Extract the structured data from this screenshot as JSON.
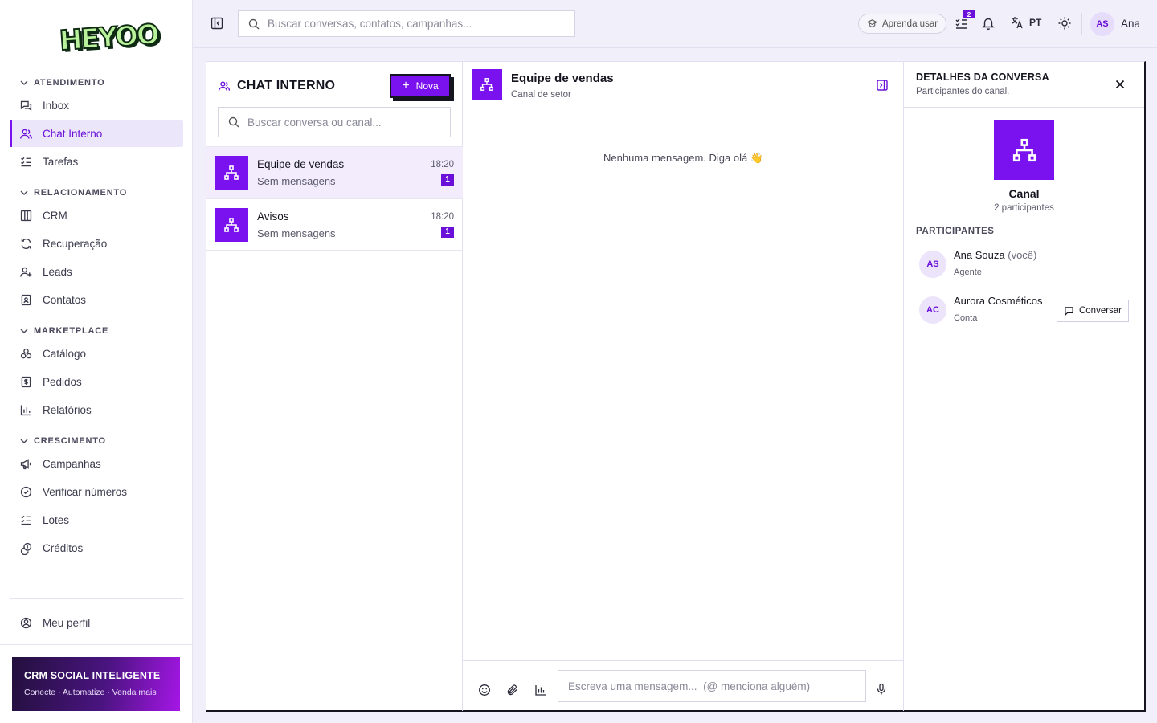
{
  "brand": {
    "logo_text": "HEYOO"
  },
  "sidebar": {
    "sections": [
      {
        "title": "ATENDIMENTO",
        "items": [
          {
            "label": "Inbox",
            "icon": "inbox-icon"
          },
          {
            "label": "Chat Interno",
            "icon": "users-icon",
            "active": true
          },
          {
            "label": "Tarefas",
            "icon": "tasks-icon"
          }
        ]
      },
      {
        "title": "RELACIONAMENTO",
        "items": [
          {
            "label": "CRM",
            "icon": "columns-icon"
          },
          {
            "label": "Recuperação",
            "icon": "refresh-icon"
          },
          {
            "label": "Leads",
            "icon": "user-plus-icon"
          },
          {
            "label": "Contatos",
            "icon": "contact-book-icon"
          }
        ]
      },
      {
        "title": "MARKETPLACE",
        "items": [
          {
            "label": "Catálogo",
            "icon": "boxes-icon"
          },
          {
            "label": "Pedidos",
            "icon": "receipt-icon"
          },
          {
            "label": "Relatórios",
            "icon": "bar-chart-icon"
          }
        ]
      },
      {
        "title": "CRESCIMENTO",
        "items": [
          {
            "label": "Campanhas",
            "icon": "megaphone-icon"
          },
          {
            "label": "Verificar números",
            "icon": "check-circle-icon"
          },
          {
            "label": "Lotes",
            "icon": "list-check-icon"
          },
          {
            "label": "Créditos",
            "icon": "coins-icon"
          }
        ]
      }
    ],
    "profile_label": "Meu perfil",
    "promo": {
      "title": "CRM SOCIAL INTELIGENTE",
      "subtitle": "Conecte · Automatize · Venda mais"
    }
  },
  "topbar": {
    "search_placeholder": "Buscar conversas, contatos, campanhas...",
    "learn_label": "Aprenda usar",
    "tasks_badge": "2",
    "lang": "PT",
    "user_initials": "AS",
    "user_name": "Ana"
  },
  "chat_list": {
    "title": "CHAT INTERNO",
    "new_label": "Nova",
    "search_placeholder": "Buscar conversa ou canal...",
    "conversations": [
      {
        "name": "Equipe de vendas",
        "preview": "Sem mensagens",
        "time": "18:20",
        "unread": "1",
        "active": true
      },
      {
        "name": "Avisos",
        "preview": "Sem mensagens",
        "time": "18:20",
        "unread": "1",
        "active": false
      }
    ]
  },
  "chat": {
    "name": "Equipe de vendas",
    "subtitle": "Canal de setor",
    "empty_message": "Nenhuma mensagem. Diga olá 👋",
    "composer_placeholder": "Escreva uma mensagem...  (@ menciona alguém)"
  },
  "details": {
    "title": "DETALHES DA CONVERSA",
    "subtitle": "Participantes do canal.",
    "kind": "Canal",
    "participants_count": "2 participantes",
    "participants_label": "PARTICIPANTES",
    "participants": [
      {
        "initials": "AS",
        "name": "Ana Souza",
        "suffix": "(você)",
        "role": "Agente"
      },
      {
        "initials": "AC",
        "name": "Aurora Cosméticos",
        "suffix": "",
        "role": "Conta",
        "action": "Conversar"
      }
    ]
  },
  "colors": {
    "accent": "#7a12f0",
    "accent_dark": "#6a10d8",
    "active_bg": "#ece6fb",
    "border_dark": "#15151f"
  }
}
